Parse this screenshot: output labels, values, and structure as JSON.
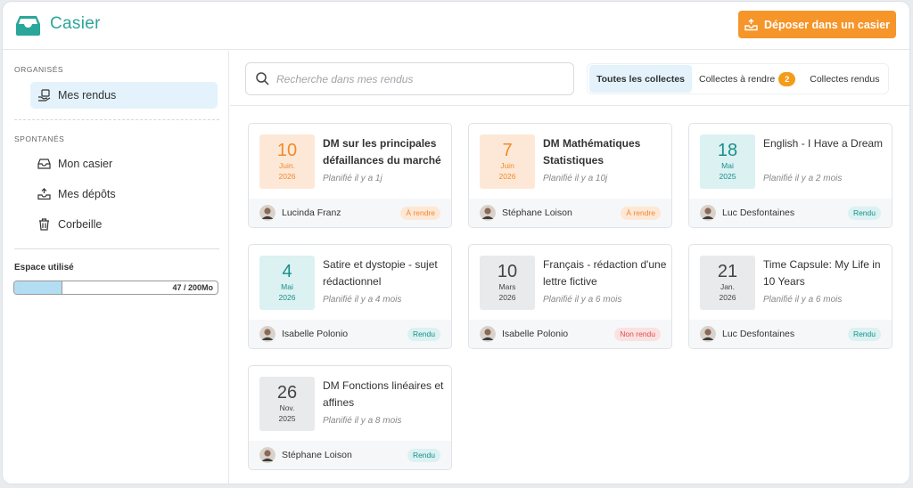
{
  "app": {
    "title": "Casier",
    "accent": "#2aa69a",
    "cta_color": "#f5952a"
  },
  "header": {
    "deposit_label": "Déposer dans un casier"
  },
  "sidebar": {
    "organised_label": "ORGANISÉS",
    "organised_items": [
      {
        "label": "Mes rendus",
        "icon": "hand-document-icon",
        "active": true
      }
    ],
    "spontaneous_label": "SPONTANÉS",
    "spontaneous_items": [
      {
        "label": "Mon casier",
        "icon": "inbox-icon"
      },
      {
        "label": "Mes dépôts",
        "icon": "tray-upload-icon"
      },
      {
        "label": "Corbeille",
        "icon": "trash-icon"
      }
    ],
    "usage": {
      "label": "Espace utilisé",
      "text": "47 / 200Mo",
      "fraction": 0.235
    }
  },
  "filters": {
    "search_placeholder": "Recherche dans mes rendus",
    "tabs": [
      {
        "label": "Toutes les collectes",
        "active": true
      },
      {
        "label": "Collectes à rendre",
        "badge": "2"
      },
      {
        "label": "Collectes rendus"
      }
    ]
  },
  "cards": [
    {
      "day": "10",
      "month": "Juin.",
      "year": "2026",
      "tone": "orange",
      "title": "DM sur les principales défaillances du marché",
      "bold": true,
      "planned": "Planifié il y a 1j",
      "author": "Lucinda Franz",
      "status": "À rendre",
      "status_type": "todo"
    },
    {
      "day": "7",
      "month": "Juin",
      "year": "2026",
      "tone": "orange",
      "title": "DM Mathématiques Statistiques",
      "bold": true,
      "planned": "Planifié il y a 10j",
      "author": "Stéphane Loison",
      "status": "À rendre",
      "status_type": "todo"
    },
    {
      "day": "18",
      "month": "Mai",
      "year": "2025",
      "tone": "teal",
      "title": "English - I Have a Dream",
      "bold": false,
      "planned": "Planifié il y a 2 mois",
      "author": "Luc Desfontaines",
      "status": "Rendu",
      "status_type": "done"
    },
    {
      "day": "4",
      "month": "Mai",
      "year": "2026",
      "tone": "teal",
      "title": "Satire et dystopie - sujet rédactionnel",
      "bold": false,
      "planned": "Planifié il y a 4 mois",
      "author": "Isabelle Polonio",
      "status": "Rendu",
      "status_type": "done"
    },
    {
      "day": "10",
      "month": "Mars",
      "year": "2026",
      "tone": "grey",
      "title": "Français - rédaction d'une lettre fictive",
      "bold": false,
      "planned": "Planifié il y a 6 mois",
      "author": "Isabelle Polonio",
      "status": "Non rendu",
      "status_type": "not"
    },
    {
      "day": "21",
      "month": "Jan.",
      "year": "2026",
      "tone": "grey",
      "title": "Time Capsule: My Life in 10 Years",
      "bold": false,
      "planned": "Planifié il y a 6 mois",
      "author": "Luc Desfontaines",
      "status": "Rendu",
      "status_type": "done"
    },
    {
      "day": "26",
      "month": "Nov.",
      "year": "2025",
      "tone": "grey",
      "title": "DM Fonctions linéaires et affines",
      "bold": false,
      "planned": "Planifié il y a 8 mois",
      "author": "Stéphane Loison",
      "status": "Rendu",
      "status_type": "done"
    }
  ]
}
